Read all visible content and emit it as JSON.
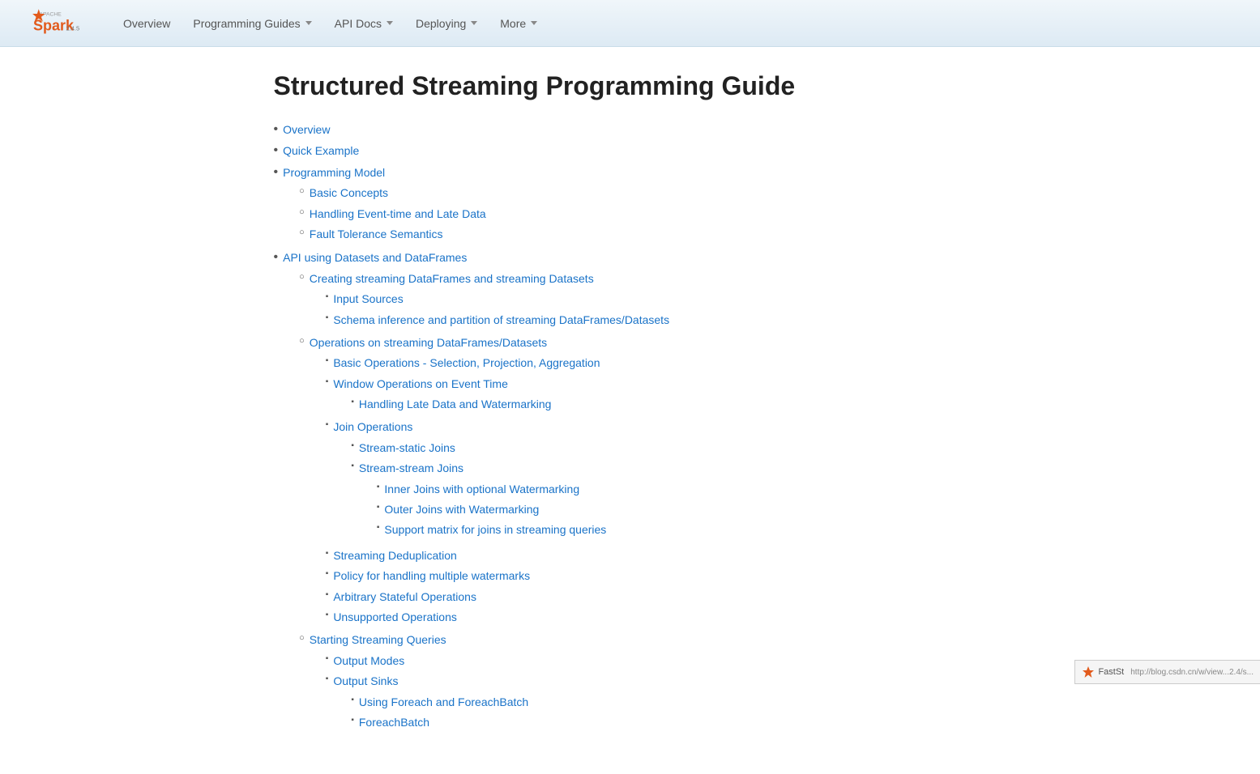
{
  "navbar": {
    "version": "2.4.5",
    "links": [
      {
        "label": "Overview",
        "hasDropdown": false
      },
      {
        "label": "Programming Guides",
        "hasDropdown": true
      },
      {
        "label": "API Docs",
        "hasDropdown": true
      },
      {
        "label": "Deploying",
        "hasDropdown": true
      },
      {
        "label": "More",
        "hasDropdown": true
      }
    ]
  },
  "page": {
    "title": "Structured Streaming Programming Guide"
  },
  "toc": {
    "items": [
      {
        "label": "Overview",
        "href": "#overview",
        "children": []
      },
      {
        "label": "Quick Example",
        "href": "#quick-example",
        "children": []
      },
      {
        "label": "Programming Model",
        "href": "#programming-model",
        "children": [
          {
            "label": "Basic Concepts",
            "href": "#basic-concepts",
            "children": []
          },
          {
            "label": "Handling Event-time and Late Data",
            "href": "#handling-event-time",
            "children": []
          },
          {
            "label": "Fault Tolerance Semantics",
            "href": "#fault-tolerance",
            "children": []
          }
        ]
      },
      {
        "label": "API using Datasets and DataFrames",
        "href": "#api-datasets-dataframes",
        "children": [
          {
            "label": "Creating streaming DataFrames and streaming Datasets",
            "href": "#creating-streaming",
            "children": [
              {
                "label": "Input Sources",
                "href": "#input-sources",
                "children": []
              },
              {
                "label": "Schema inference and partition of streaming DataFrames/Datasets",
                "href": "#schema-inference",
                "children": []
              }
            ]
          },
          {
            "label": "Operations on streaming DataFrames/Datasets",
            "href": "#operations-streaming",
            "children": [
              {
                "label": "Basic Operations - Selection, Projection, Aggregation",
                "href": "#basic-operations",
                "children": []
              },
              {
                "label": "Window Operations on Event Time",
                "href": "#window-operations",
                "children": [
                  {
                    "label": "Handling Late Data and Watermarking",
                    "href": "#handling-late-data"
                  }
                ]
              },
              {
                "label": "Join Operations",
                "href": "#join-operations",
                "children": [
                  {
                    "label": "Stream-static Joins",
                    "href": "#stream-static-joins",
                    "children": []
                  },
                  {
                    "label": "Stream-stream Joins",
                    "href": "#stream-stream-joins",
                    "subchildren": [
                      {
                        "label": "Inner Joins with optional Watermarking",
                        "href": "#inner-joins"
                      },
                      {
                        "label": "Outer Joins with Watermarking",
                        "href": "#outer-joins"
                      },
                      {
                        "label": "Support matrix for joins in streaming queries",
                        "href": "#support-matrix"
                      }
                    ]
                  }
                ]
              },
              {
                "label": "Streaming Deduplication",
                "href": "#streaming-dedup",
                "children": []
              },
              {
                "label": "Policy for handling multiple watermarks",
                "href": "#policy-watermarks",
                "children": []
              },
              {
                "label": "Arbitrary Stateful Operations",
                "href": "#arbitrary-stateful",
                "children": []
              },
              {
                "label": "Unsupported Operations",
                "href": "#unsupported-operations",
                "children": []
              }
            ]
          },
          {
            "label": "Starting Streaming Queries",
            "href": "#starting-queries",
            "children": [
              {
                "label": "Output Modes",
                "href": "#output-modes",
                "children": []
              },
              {
                "label": "Output Sinks",
                "href": "#output-sinks",
                "children": [
                  {
                    "label": "Using Foreach and ForeachBatch",
                    "href": "#foreach"
                  },
                  {
                    "label": "ForeachBatch",
                    "href": "#foreachbatch"
                  }
                ]
              }
            ]
          }
        ]
      }
    ]
  },
  "corner_widget": {
    "label": "FastSt",
    "url": "http://blog.csdn.cn/w/view...2.4/s..."
  }
}
